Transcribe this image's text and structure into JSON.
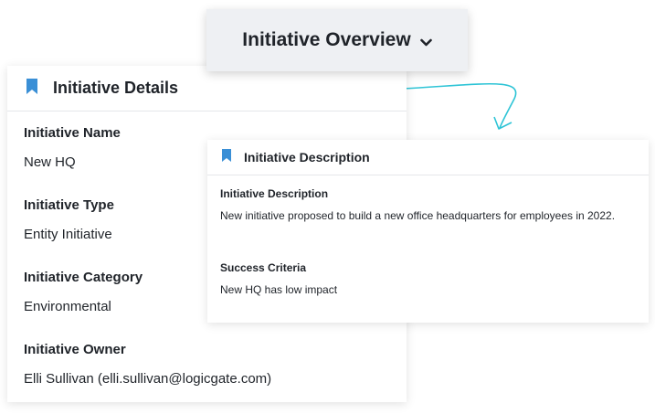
{
  "dropdown": {
    "label": "Initiative Overview",
    "icon": "chevron-down-icon"
  },
  "details_card": {
    "title": "Initiative Details",
    "icon": "bookmark-icon",
    "fields": [
      {
        "label": "Initiative Name",
        "value": "New HQ"
      },
      {
        "label": "Initiative Type",
        "value": "Entity Initiative"
      },
      {
        "label": "Initiative Category",
        "value": "Environmental"
      },
      {
        "label": "Initiative Owner",
        "value": "Elli Sullivan (elli.sullivan@logicgate.com)"
      }
    ]
  },
  "description_card": {
    "title": "Initiative Description",
    "icon": "bookmark-icon",
    "fields": [
      {
        "label": "Initiative Description",
        "value": "New initiative proposed to build a new office headquarters for employees in 2022."
      },
      {
        "label": "Success Criteria",
        "value": "New HQ has low impact"
      }
    ]
  },
  "colors": {
    "accent": "#3a8fd6",
    "arrow": "#2ec4d6",
    "dropdown_bg": "#eef0f3"
  }
}
